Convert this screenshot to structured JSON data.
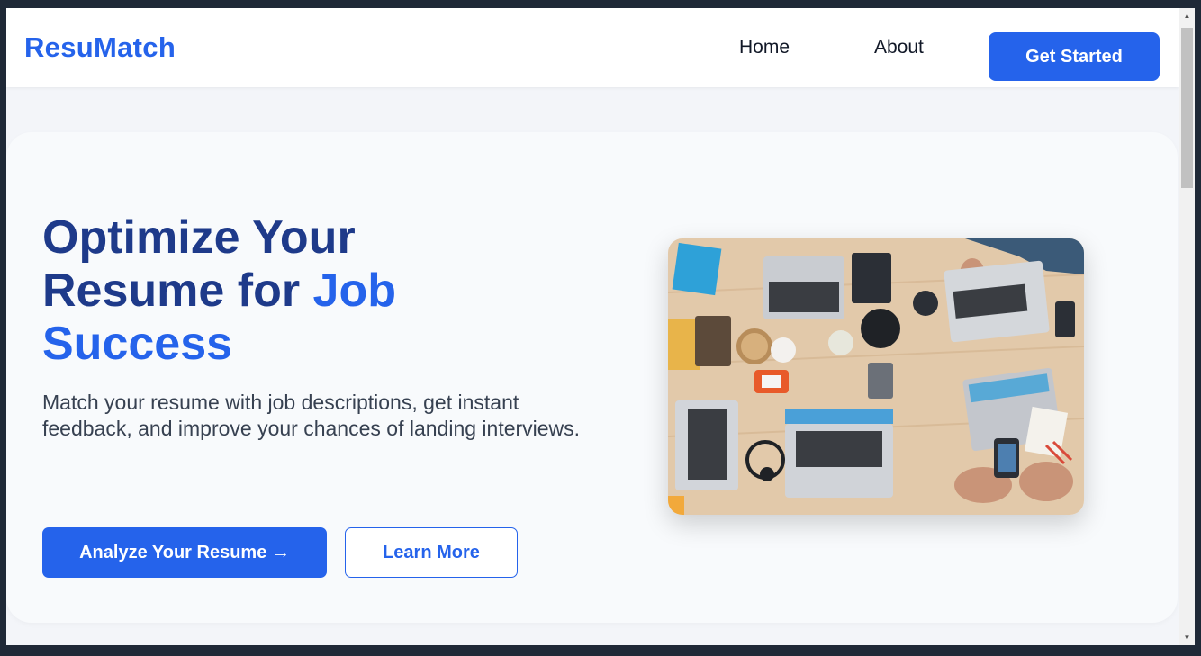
{
  "navbar": {
    "logo": "ResuMatch",
    "links": [
      {
        "label": "Home"
      },
      {
        "label": "About"
      }
    ],
    "cta_label": "Get Started"
  },
  "hero": {
    "title_line1": "Optimize Your",
    "title_line2_a": "Resume for ",
    "title_line2_b": "Job",
    "title_line3": "Success",
    "subtitle": "Match your resume with job descriptions, get instant feedback, and improve your chances of landing interviews.",
    "primary_button": "Analyze Your Resume →",
    "secondary_button": "Learn More",
    "image_icon": "team-laptops-photo"
  },
  "colors": {
    "brand": "#2563eb",
    "title_dark": "#1e3a8a",
    "body_text": "#374151",
    "page_bg": "#f3f5f9"
  }
}
